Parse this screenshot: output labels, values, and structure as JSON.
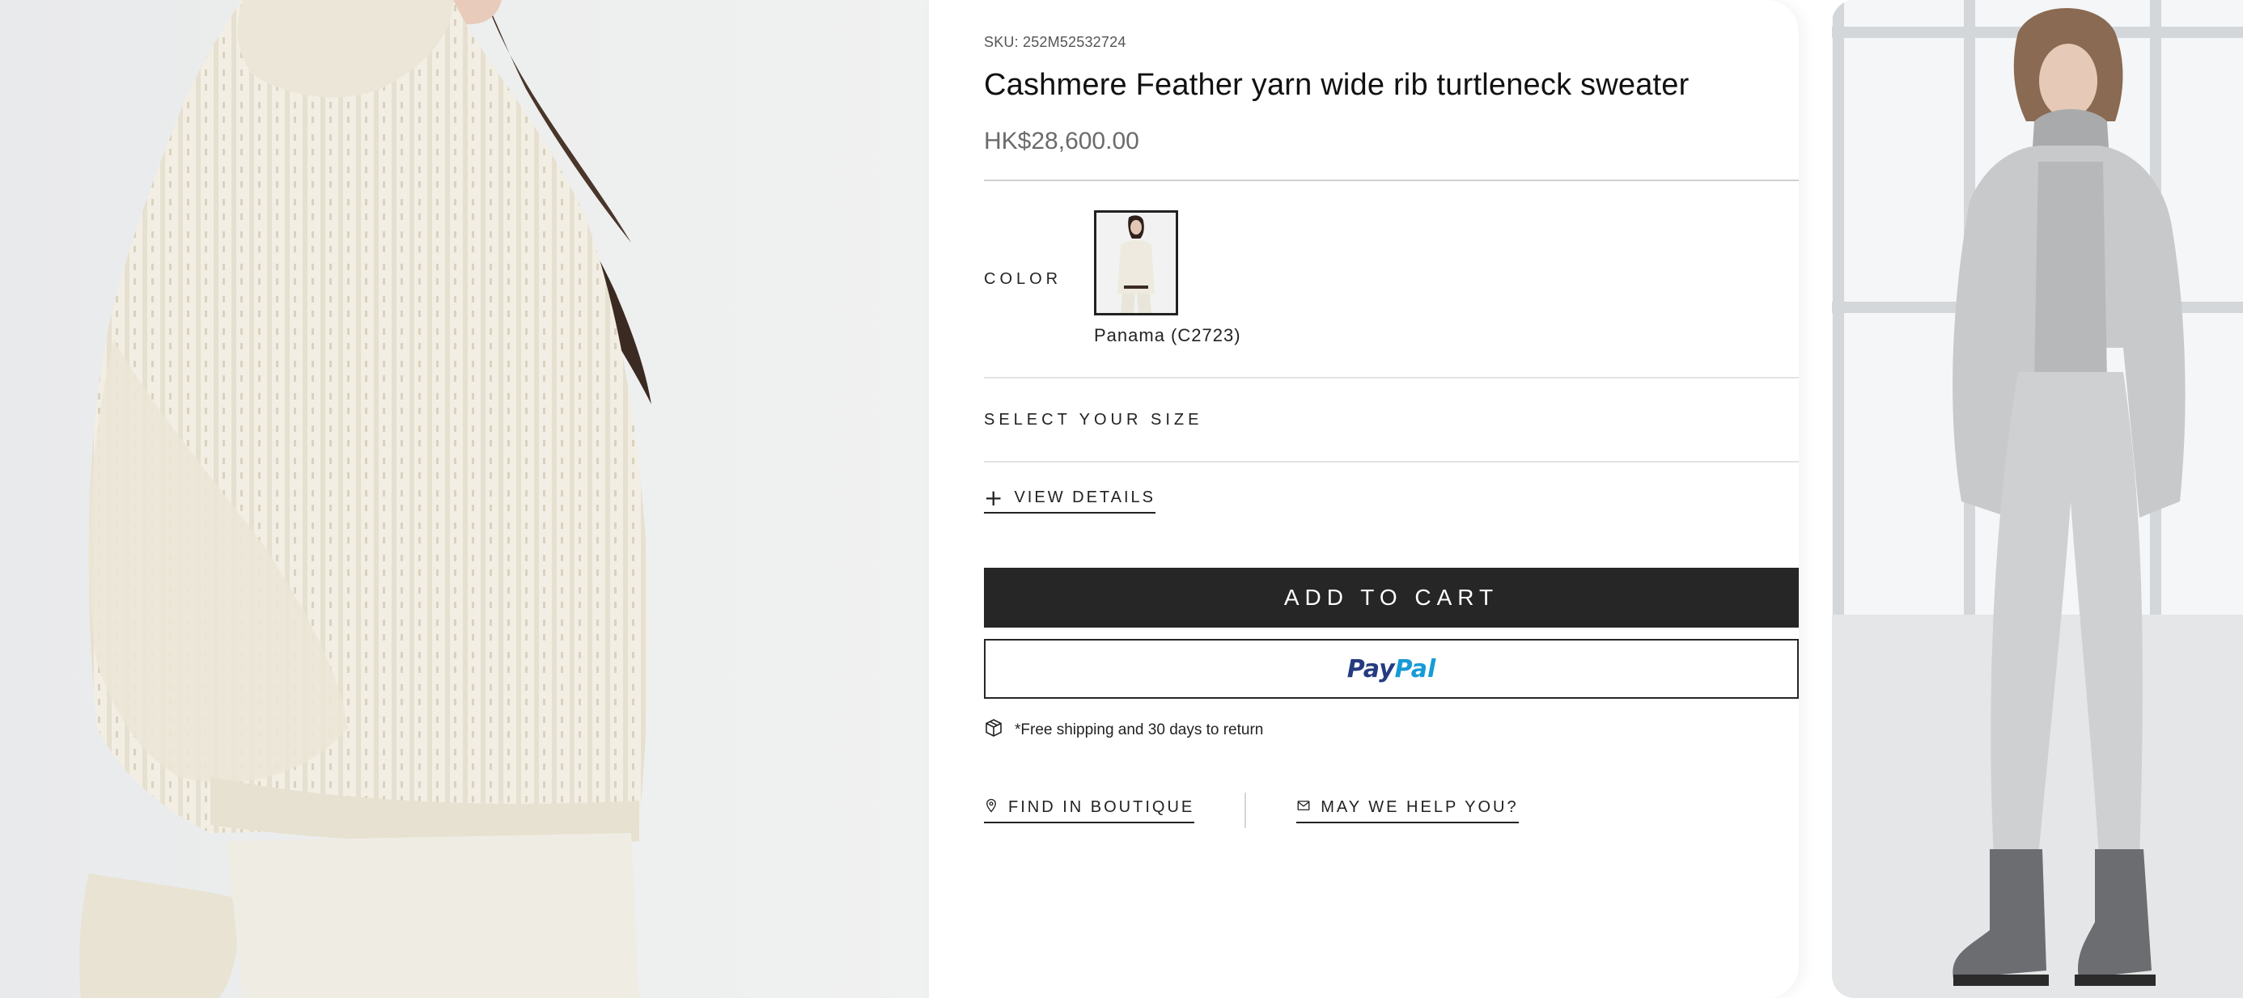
{
  "product": {
    "sku": "SKU: 252M52532724",
    "title": "Cashmere Feather yarn wide rib turtleneck sweater",
    "price": "HK$28,600.00"
  },
  "color": {
    "label": "COLOR",
    "selected_name": "Panama (C2723)"
  },
  "size": {
    "label": "SELECT YOUR SIZE"
  },
  "details": {
    "label": "VIEW DETAILS",
    "icon": "plus-icon"
  },
  "actions": {
    "add_to_cart": "ADD TO CART",
    "paypal_part1": "Pay",
    "paypal_part2": "Pal"
  },
  "shipping": {
    "text": "*Free shipping and 30 days to return",
    "icon": "package-icon"
  },
  "links": {
    "find_boutique": "FIND IN BOUTIQUE",
    "help": "MAY WE HELP YOU?",
    "find_boutique_icon": "location-pin-icon",
    "help_icon": "mail-icon"
  },
  "colors": {
    "cart_bg": "#262626",
    "paypal_dark": "#253b80",
    "paypal_light": "#179bd7",
    "sweater": "#f1ede2"
  }
}
